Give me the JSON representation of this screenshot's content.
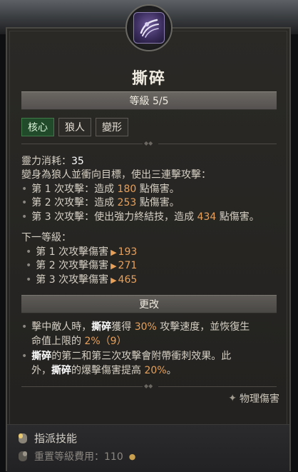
{
  "skill": {
    "title": "撕碎",
    "level_label": "等級 5/5",
    "tags": [
      "核心",
      "狼人",
      "變形"
    ],
    "cost_label": "靈力消耗：",
    "cost_value": "35",
    "description": "變身為狼人並衝向目標，使出三連擊攻擊：",
    "hits": [
      {
        "pre": "第 1 次攻擊：造成 ",
        "value": "180",
        "post": " 點傷害。"
      },
      {
        "pre": "第 2 次攻擊：造成 ",
        "value": "253",
        "post": " 點傷害。"
      },
      {
        "pre": "第 3 次攻擊：使出強力終結技，造成 ",
        "value": "434",
        "post": " 點傷害。"
      }
    ],
    "next_level_label": "下一等級：",
    "next_level": [
      {
        "label": "第 1 次攻擊傷害",
        "value": "193"
      },
      {
        "label": "第 2 次攻擊傷害",
        "value": "271"
      },
      {
        "label": "第 3 次攻擊傷害",
        "value": "465"
      }
    ],
    "modifiers_label": "更改",
    "modifier1": {
      "a": "擊中敵人時，",
      "b": "撕碎",
      "c": "獲得 ",
      "d": "30%",
      "e": " 攻擊速度，並恢復生",
      "f": "命值上限的 ",
      "g": "2%",
      "h": "（9）"
    },
    "modifier2": {
      "a": "撕碎",
      "b": "的第二和第三次攻擊會附帶衝刺效果。此",
      "c": "外，",
      "d": "撕碎",
      "e": "的爆擊傷害提高 ",
      "f": "20%",
      "g": "。"
    },
    "damage_type": "物理傷害"
  },
  "footer": {
    "assign_label": "指派技能",
    "reset_label": "重置等級費用：110"
  },
  "colors": {
    "accent_orange": "#e8a15a",
    "core_tag_green": "#214a2a",
    "skill_purple": "#6e5a9a"
  }
}
